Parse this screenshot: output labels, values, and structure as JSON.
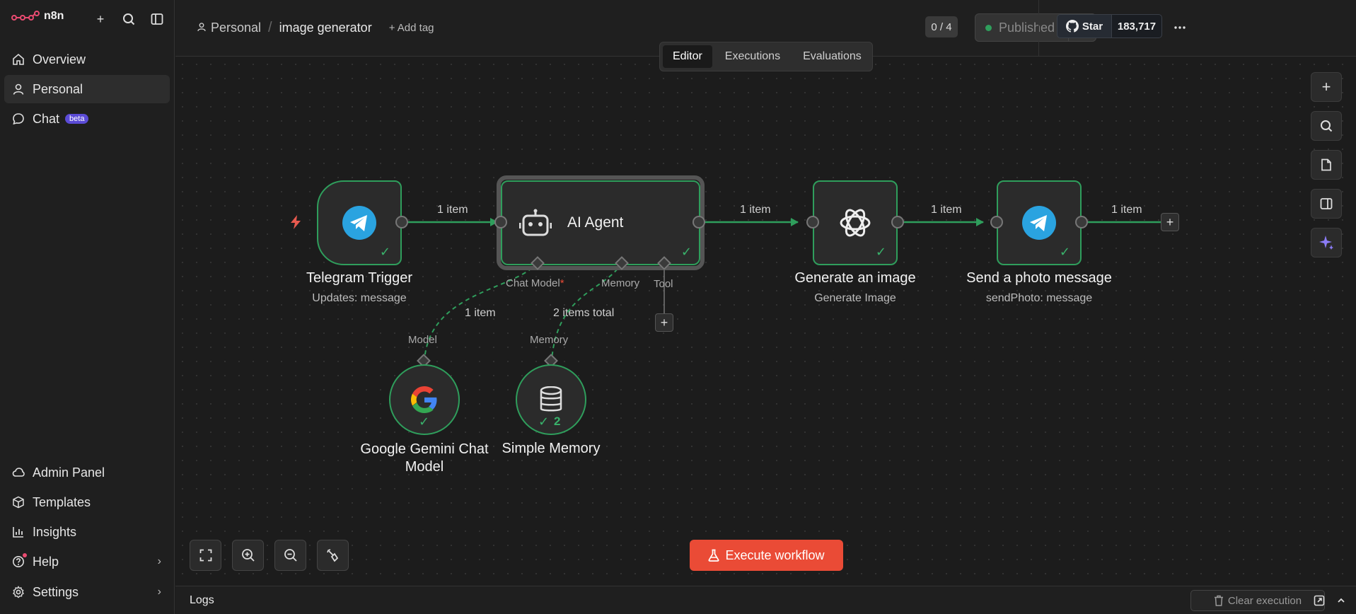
{
  "app": {
    "logo_text": "n8n"
  },
  "sidebar": {
    "nav": [
      {
        "label": "Overview",
        "icon": "home-icon"
      },
      {
        "label": "Personal",
        "icon": "user-icon"
      },
      {
        "label": "Chat",
        "icon": "chat-icon",
        "badge": "beta"
      }
    ],
    "bottom": [
      {
        "label": "Admin Panel",
        "icon": "cloud-icon"
      },
      {
        "label": "Templates",
        "icon": "box-icon"
      },
      {
        "label": "Insights",
        "icon": "bar-chart-icon"
      },
      {
        "label": "Help",
        "icon": "help-icon"
      },
      {
        "label": "Settings",
        "icon": "gear-icon"
      }
    ]
  },
  "header": {
    "breadcrumb_owner": "Personal",
    "breadcrumb_sep": "/",
    "workflow_name": "image generator",
    "add_tag": "+ Add tag",
    "counter": "0 / 4",
    "publish_label": "Published",
    "github_star": "Star",
    "github_count": "183,717"
  },
  "tabs": [
    {
      "label": "Editor",
      "active": true
    },
    {
      "label": "Executions",
      "active": false
    },
    {
      "label": "Evaluations",
      "active": false
    }
  ],
  "workflow": {
    "nodes": {
      "telegram_trigger": {
        "title": "Telegram Trigger",
        "subtitle": "Updates: message"
      },
      "ai_agent": {
        "title": "AI Agent"
      },
      "generate_image": {
        "title": "Generate an image",
        "subtitle": "Generate Image"
      },
      "send_photo": {
        "title": "Send a photo message",
        "subtitle": "sendPhoto: message"
      },
      "gemini": {
        "title_line1": "Google Gemini Chat",
        "title_line2": "Model"
      },
      "memory": {
        "title": "Simple Memory",
        "count": "2"
      }
    },
    "edges": {
      "trigger_agent": "1 item",
      "agent_image": "1 item",
      "image_send": "1 item",
      "send_out": "1 item",
      "model_link": "1 item",
      "memory_link": "2 items total"
    },
    "ports": {
      "chat_model": "Chat Model",
      "required_mark": "*",
      "memory": "Memory",
      "tool": "Tool",
      "model_in": "Model",
      "memory_in": "Memory"
    }
  },
  "footer": {
    "execute": "Execute workflow",
    "logs": "Logs",
    "clear": "Clear execution"
  },
  "colors": {
    "accent": "#ea4b36",
    "success": "#2f9e5c",
    "beta": "#5b4bd6"
  }
}
